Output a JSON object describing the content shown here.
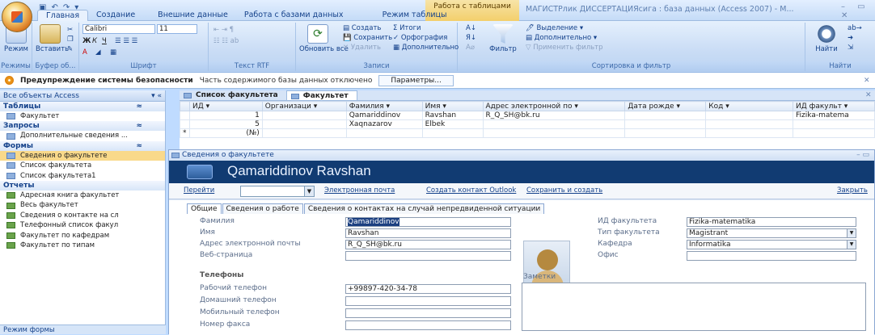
{
  "app": {
    "context_tab_line1": "Работа с таблицами",
    "window_title": "МАГИСТРлик ДИССЕРТАЦИЯсига : база данных (Access 2007) - М...",
    "win_controls": "– ▭ ✕",
    "qat_icons": [
      "save-icon",
      "undo-icon",
      "redo-icon"
    ]
  },
  "tabs": [
    "Главная",
    "Создание",
    "Внешние данные",
    "Работа с базами данных",
    "Режим таблицы"
  ],
  "ribbon": {
    "mode_label": "Режим",
    "paste_label": "Вставить",
    "font_name": "Calibri",
    "font_size": "11",
    "refresh_label": "Обновить все",
    "records_create": "Создать",
    "records_save": "Сохранить",
    "records_delete": "Удалить",
    "records_totals": "Итоги",
    "records_spelling": "Орфография",
    "records_more": "Дополнительно",
    "filter_label": "Фильтр",
    "selection": "Выделение",
    "advanced": "Дополнительно",
    "apply_filter": "Применить фильтр",
    "find_label": "Найти",
    "groups": [
      "Режимы",
      "Буфер об...",
      "Шрифт",
      "Текст RTF",
      "Записи",
      "Сортировка и фильтр",
      "Найти"
    ]
  },
  "security": {
    "warning_bold": "Предупреждение системы безопасности",
    "warning_text": "Часть содержимого базы данных отключено",
    "button": "Параметры..."
  },
  "nav": {
    "header": "Все объекты Access",
    "sections": [
      {
        "title": "Таблицы",
        "items": [
          "Факультет"
        ]
      },
      {
        "title": "Запросы",
        "items": [
          "Дополнительные сведения ..."
        ]
      },
      {
        "title": "Формы",
        "items": [
          "Сведения о факультете",
          "Список факультета",
          "Список факультета1"
        ]
      },
      {
        "title": "Отчеты",
        "items": [
          "Адресная книга факультет",
          "Весь факультет",
          "Сведения о контакте на сл",
          "Телефонный список факул",
          "Факультет по кафедрам",
          "Факультет по типам"
        ]
      }
    ],
    "footer": "Режим формы"
  },
  "doc_tabs": [
    "Список факультета",
    "Факультет"
  ],
  "grid": {
    "columns": [
      "ИД",
      "Организаци",
      "Фамилия",
      "Имя",
      "Адрес электронной по",
      "Дата рожде",
      "Код",
      "ИД факульт"
    ],
    "rows": [
      [
        "1",
        "",
        "Qamariddinov",
        "Ravshan",
        "R_Q_SH@bk.ru",
        "",
        "",
        "Fizika-matema"
      ],
      [
        "5",
        "",
        "Xaqnazarov",
        "Elbek",
        "",
        "",
        "",
        ""
      ],
      [
        "(№)",
        "",
        "",
        "",
        "",
        "",
        "",
        ""
      ]
    ],
    "new_row_marker": "*"
  },
  "form": {
    "window_title": "Сведения о факультете",
    "header_name": "Qamariddinov Ravshan",
    "goto_label": "Перейти",
    "toolbar_links": [
      "Электронная почта",
      "Создать контакт Outlook",
      "Сохранить и создать"
    ],
    "close_label": "Закрыть",
    "tabs": [
      "Общие",
      "Сведения о работе",
      "Сведения о контактах на случай непредвиденной ситуации"
    ],
    "fields_left": [
      {
        "label": "Фамилия",
        "value": "Qamariddinov"
      },
      {
        "label": "Имя",
        "value": "Ravshan"
      },
      {
        "label": "Адрес электронной почты",
        "value": "R_Q_SH@bk.ru"
      },
      {
        "label": "Веб-страница",
        "value": ""
      }
    ],
    "phones_title": "Телефоны",
    "phones": [
      {
        "label": "Рабочий телефон",
        "value": "+99897-420-34-78"
      },
      {
        "label": "Домашний телефон",
        "value": ""
      },
      {
        "label": "Мобильный телефон",
        "value": ""
      },
      {
        "label": "Номер факса",
        "value": ""
      }
    ],
    "fields_right": [
      {
        "label": "ИД факультета",
        "value": "Fizika-matematika"
      },
      {
        "label": "Тип факультета",
        "value": "Magistrant"
      },
      {
        "label": "Кафедра",
        "value": "Informatika"
      },
      {
        "label": "Офис",
        "value": ""
      }
    ],
    "notes_label": "Заметки"
  }
}
